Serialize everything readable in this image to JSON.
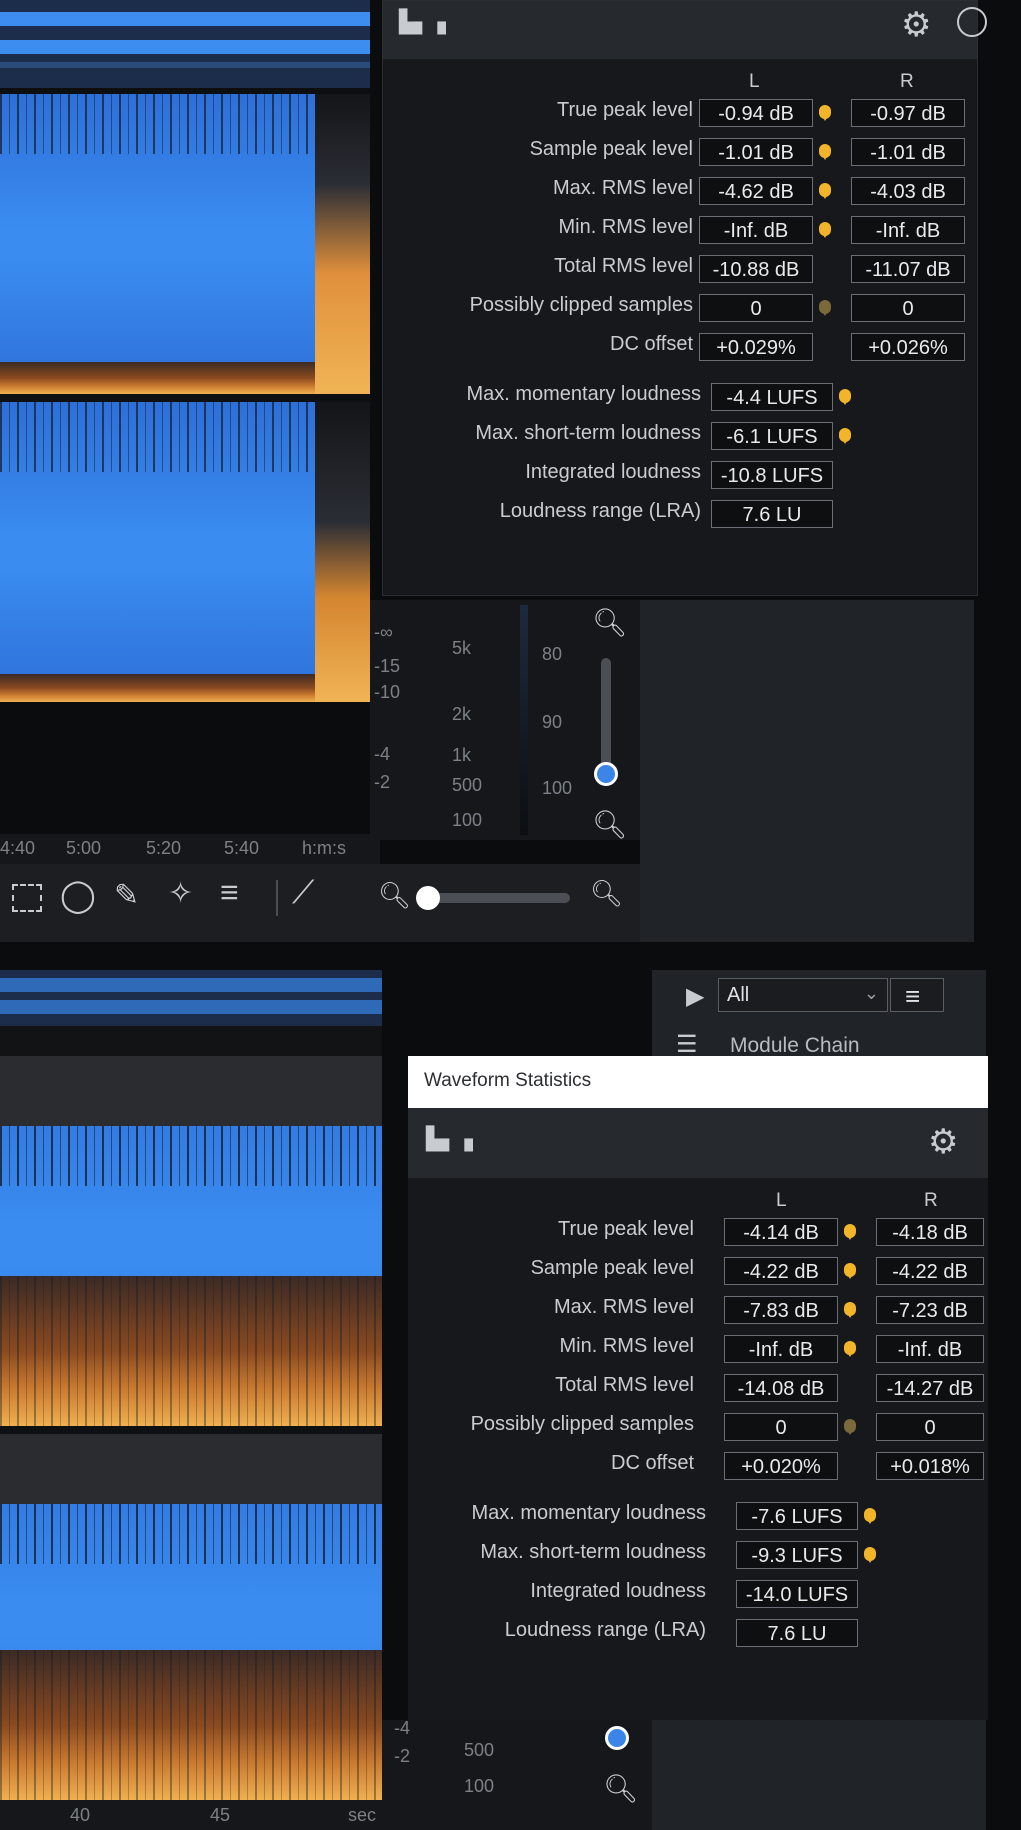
{
  "top_panel": {
    "col_l": "L",
    "col_r": "R",
    "rows": [
      {
        "label": "True peak level",
        "l": "-0.94 dB",
        "r": "-0.97 dB"
      },
      {
        "label": "Sample peak level",
        "l": "-1.01 dB",
        "r": "-1.01 dB"
      },
      {
        "label": "Max. RMS level",
        "l": "-4.62 dB",
        "r": "-4.03 dB"
      },
      {
        "label": "Min. RMS level",
        "l": "-Inf. dB",
        "r": "-Inf. dB"
      },
      {
        "label": "Total RMS level",
        "l": "-10.88 dB",
        "r": "-11.07 dB"
      },
      {
        "label": "Possibly clipped samples",
        "l": "0",
        "r": "0"
      },
      {
        "label": "DC offset",
        "l": "+0.029%",
        "r": "+0.026%"
      }
    ],
    "loudness": [
      {
        "label": "Max. momentary loudness",
        "value": "-4.4 LUFS"
      },
      {
        "label": "Max. short-term loudness",
        "value": "-6.1 LUFS"
      },
      {
        "label": "Integrated loudness",
        "value": "-10.8 LUFS"
      },
      {
        "label": "Loudness range (LRA)",
        "value": "7.6 LU"
      }
    ]
  },
  "top_axes": {
    "db_ticks": [
      "-∞",
      "-15",
      "-10",
      "-4",
      "-2"
    ],
    "freq_ticks": [
      "5k",
      "2k",
      "1k",
      "500",
      "100"
    ],
    "level_ticks": [
      "80",
      "90",
      "100"
    ],
    "time_ticks": [
      "4:40",
      "5:00",
      "5:20",
      "5:40",
      "h:m:s"
    ]
  },
  "bottom_panel": {
    "window_title": "Waveform Statistics",
    "col_l": "L",
    "col_r": "R",
    "rows": [
      {
        "label": "True peak level",
        "l": "-4.14 dB",
        "r": "-4.18 dB"
      },
      {
        "label": "Sample peak level",
        "l": "-4.22 dB",
        "r": "-4.22 dB"
      },
      {
        "label": "Max. RMS level",
        "l": "-7.83 dB",
        "r": "-7.23 dB"
      },
      {
        "label": "Min. RMS level",
        "l": "-Inf. dB",
        "r": "-Inf. dB"
      },
      {
        "label": "Total RMS level",
        "l": "-14.08 dB",
        "r": "-14.27 dB"
      },
      {
        "label": "Possibly clipped samples",
        "l": "0",
        "r": "0"
      },
      {
        "label": "DC offset",
        "l": "+0.020%",
        "r": "+0.018%"
      }
    ],
    "loudness": [
      {
        "label": "Max. momentary loudness",
        "value": "-7.6 LUFS"
      },
      {
        "label": "Max. short-term loudness",
        "value": "-9.3 LUFS"
      },
      {
        "label": "Integrated loudness",
        "value": "-14.0 LUFS"
      },
      {
        "label": "Loudness range (LRA)",
        "value": "7.6 LU"
      }
    ]
  },
  "bottom_side": {
    "dropdown_value": "All",
    "module_chain_label": "Module Chain"
  },
  "bottom_axes": {
    "db_ticks": [
      "-4",
      "-2"
    ],
    "freq_ticks": [
      "500",
      "100"
    ],
    "time_ticks": [
      "40",
      "45",
      "sec"
    ]
  },
  "icons": {
    "stats": "waveform-stats-icon",
    "settings": "gear-icon",
    "help": "help-icon",
    "play": "play-icon",
    "menu": "hamburger-icon"
  }
}
